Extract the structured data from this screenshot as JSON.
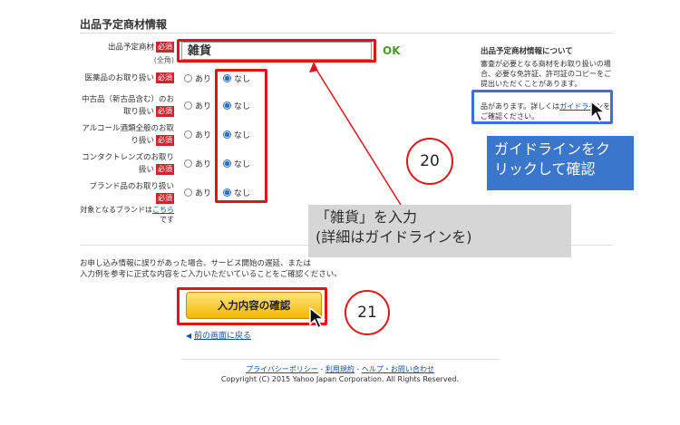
{
  "section": {
    "title": "出品予定商材情報"
  },
  "product_field": {
    "label": "出品予定商材",
    "required": "必須",
    "sub": "(全角)",
    "value": "雑貨",
    "ok": "OK"
  },
  "rows": [
    {
      "label": "医薬品のお取り扱い",
      "required": "必須",
      "opt_yes": "あり",
      "opt_no": "なし",
      "selected": "なし"
    },
    {
      "label": "中古品（新古品含む）のお取り扱い",
      "required": "必須",
      "opt_yes": "あり",
      "opt_no": "なし",
      "selected": "なし"
    },
    {
      "label": "アルコール酒類全般のお取り扱い",
      "required": "必須",
      "opt_yes": "あり",
      "opt_no": "なし",
      "selected": "なし"
    },
    {
      "label": "コンタクトレンズのお取り扱い",
      "required": "必須",
      "opt_yes": "あり",
      "opt_no": "なし",
      "selected": "なし"
    },
    {
      "label": "ブランド品のお取り扱い",
      "required": "必須",
      "opt_yes": "あり",
      "opt_no": "なし",
      "selected": "なし"
    }
  ],
  "brand_note": {
    "text": "対象となるブランドは",
    "link": "こちら",
    "suffix": "です"
  },
  "info_panel": {
    "title": "出品予定商材情報について",
    "body": "審査が必要となる商材をお取り扱いの場合、必要な免許証、許可証のコピーをご提出いただくことがあります。",
    "body2": "品があります。詳しくは",
    "link": "ガイドライン",
    "body3": "をご確認ください。"
  },
  "notice": {
    "line1": "お申し込み情報に誤りがあった場合、サービス開始の遅延、または",
    "line2": "入力例を参考に正式な内容をご入力いただいていることをご確認ください。"
  },
  "submit": {
    "label": "入力内容の確認"
  },
  "back": {
    "label": "前の画面に戻る",
    "arrow": "◀"
  },
  "footer": {
    "privacy": "プライバシーポリシー",
    "terms": "利用規約",
    "help": "ヘルプ・お問い合わせ",
    "sep": " - ",
    "copyright": "Copyright (C) 2015 Yahoo Japan Corporation. All Rights Reserved."
  },
  "annotations": {
    "step20": "20",
    "step21": "21",
    "callout_guideline_1": "ガイドラインをク",
    "callout_guideline_2": "リックして確認",
    "callout_input_1": "「雑貨」を入力",
    "callout_input_2": "(詳細はガイドラインを)"
  },
  "colors": {
    "annotation_red": "#e0141b",
    "annotation_blue": "#3b6fe0",
    "required_badge": "#c8282f",
    "ok_green": "#4a9a2a",
    "button_yellow": "#f5b700"
  }
}
